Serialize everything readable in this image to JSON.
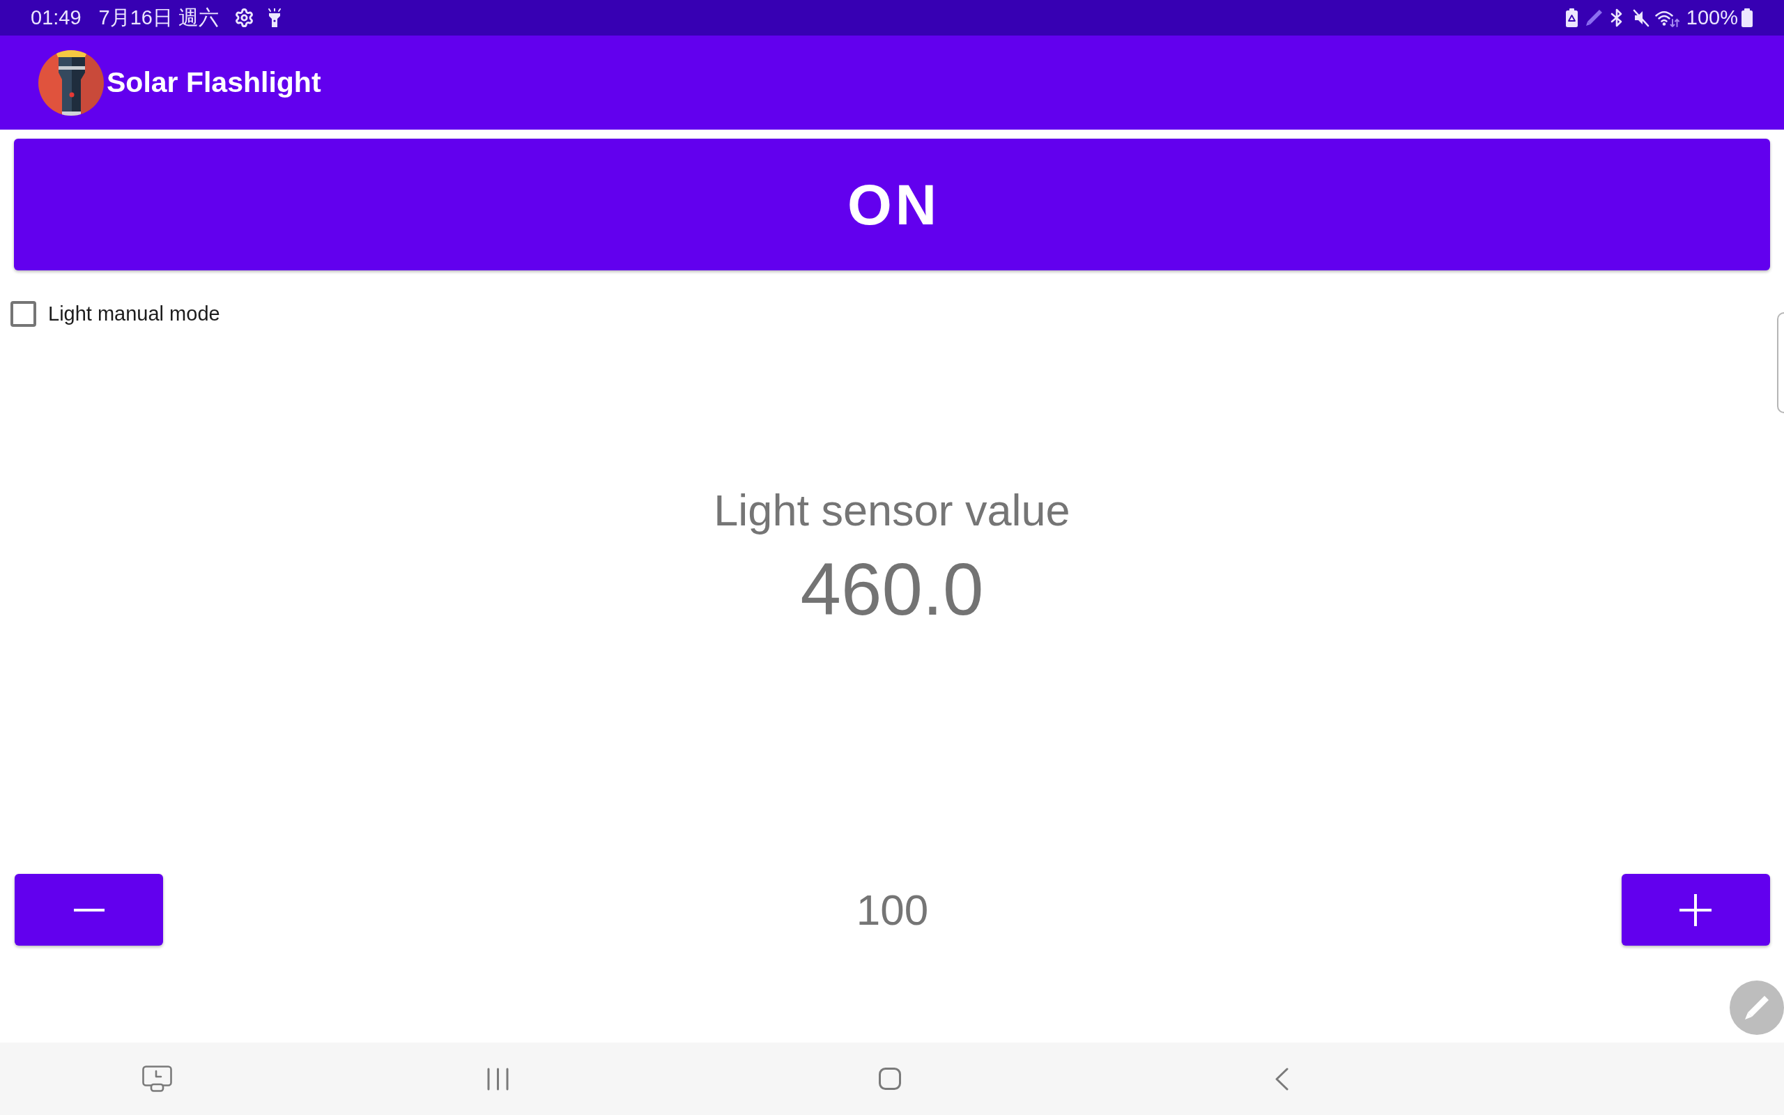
{
  "status_bar": {
    "time": "01:49",
    "date": "7月16日 週六",
    "battery": "100%"
  },
  "app_bar": {
    "title": "Solar Flashlight"
  },
  "toggle_button": {
    "label": "ON"
  },
  "manual_mode": {
    "label": "Light manual mode",
    "checked": false
  },
  "sensor": {
    "label": "Light sensor value",
    "value": "460.0"
  },
  "stepper": {
    "value": "100"
  }
}
